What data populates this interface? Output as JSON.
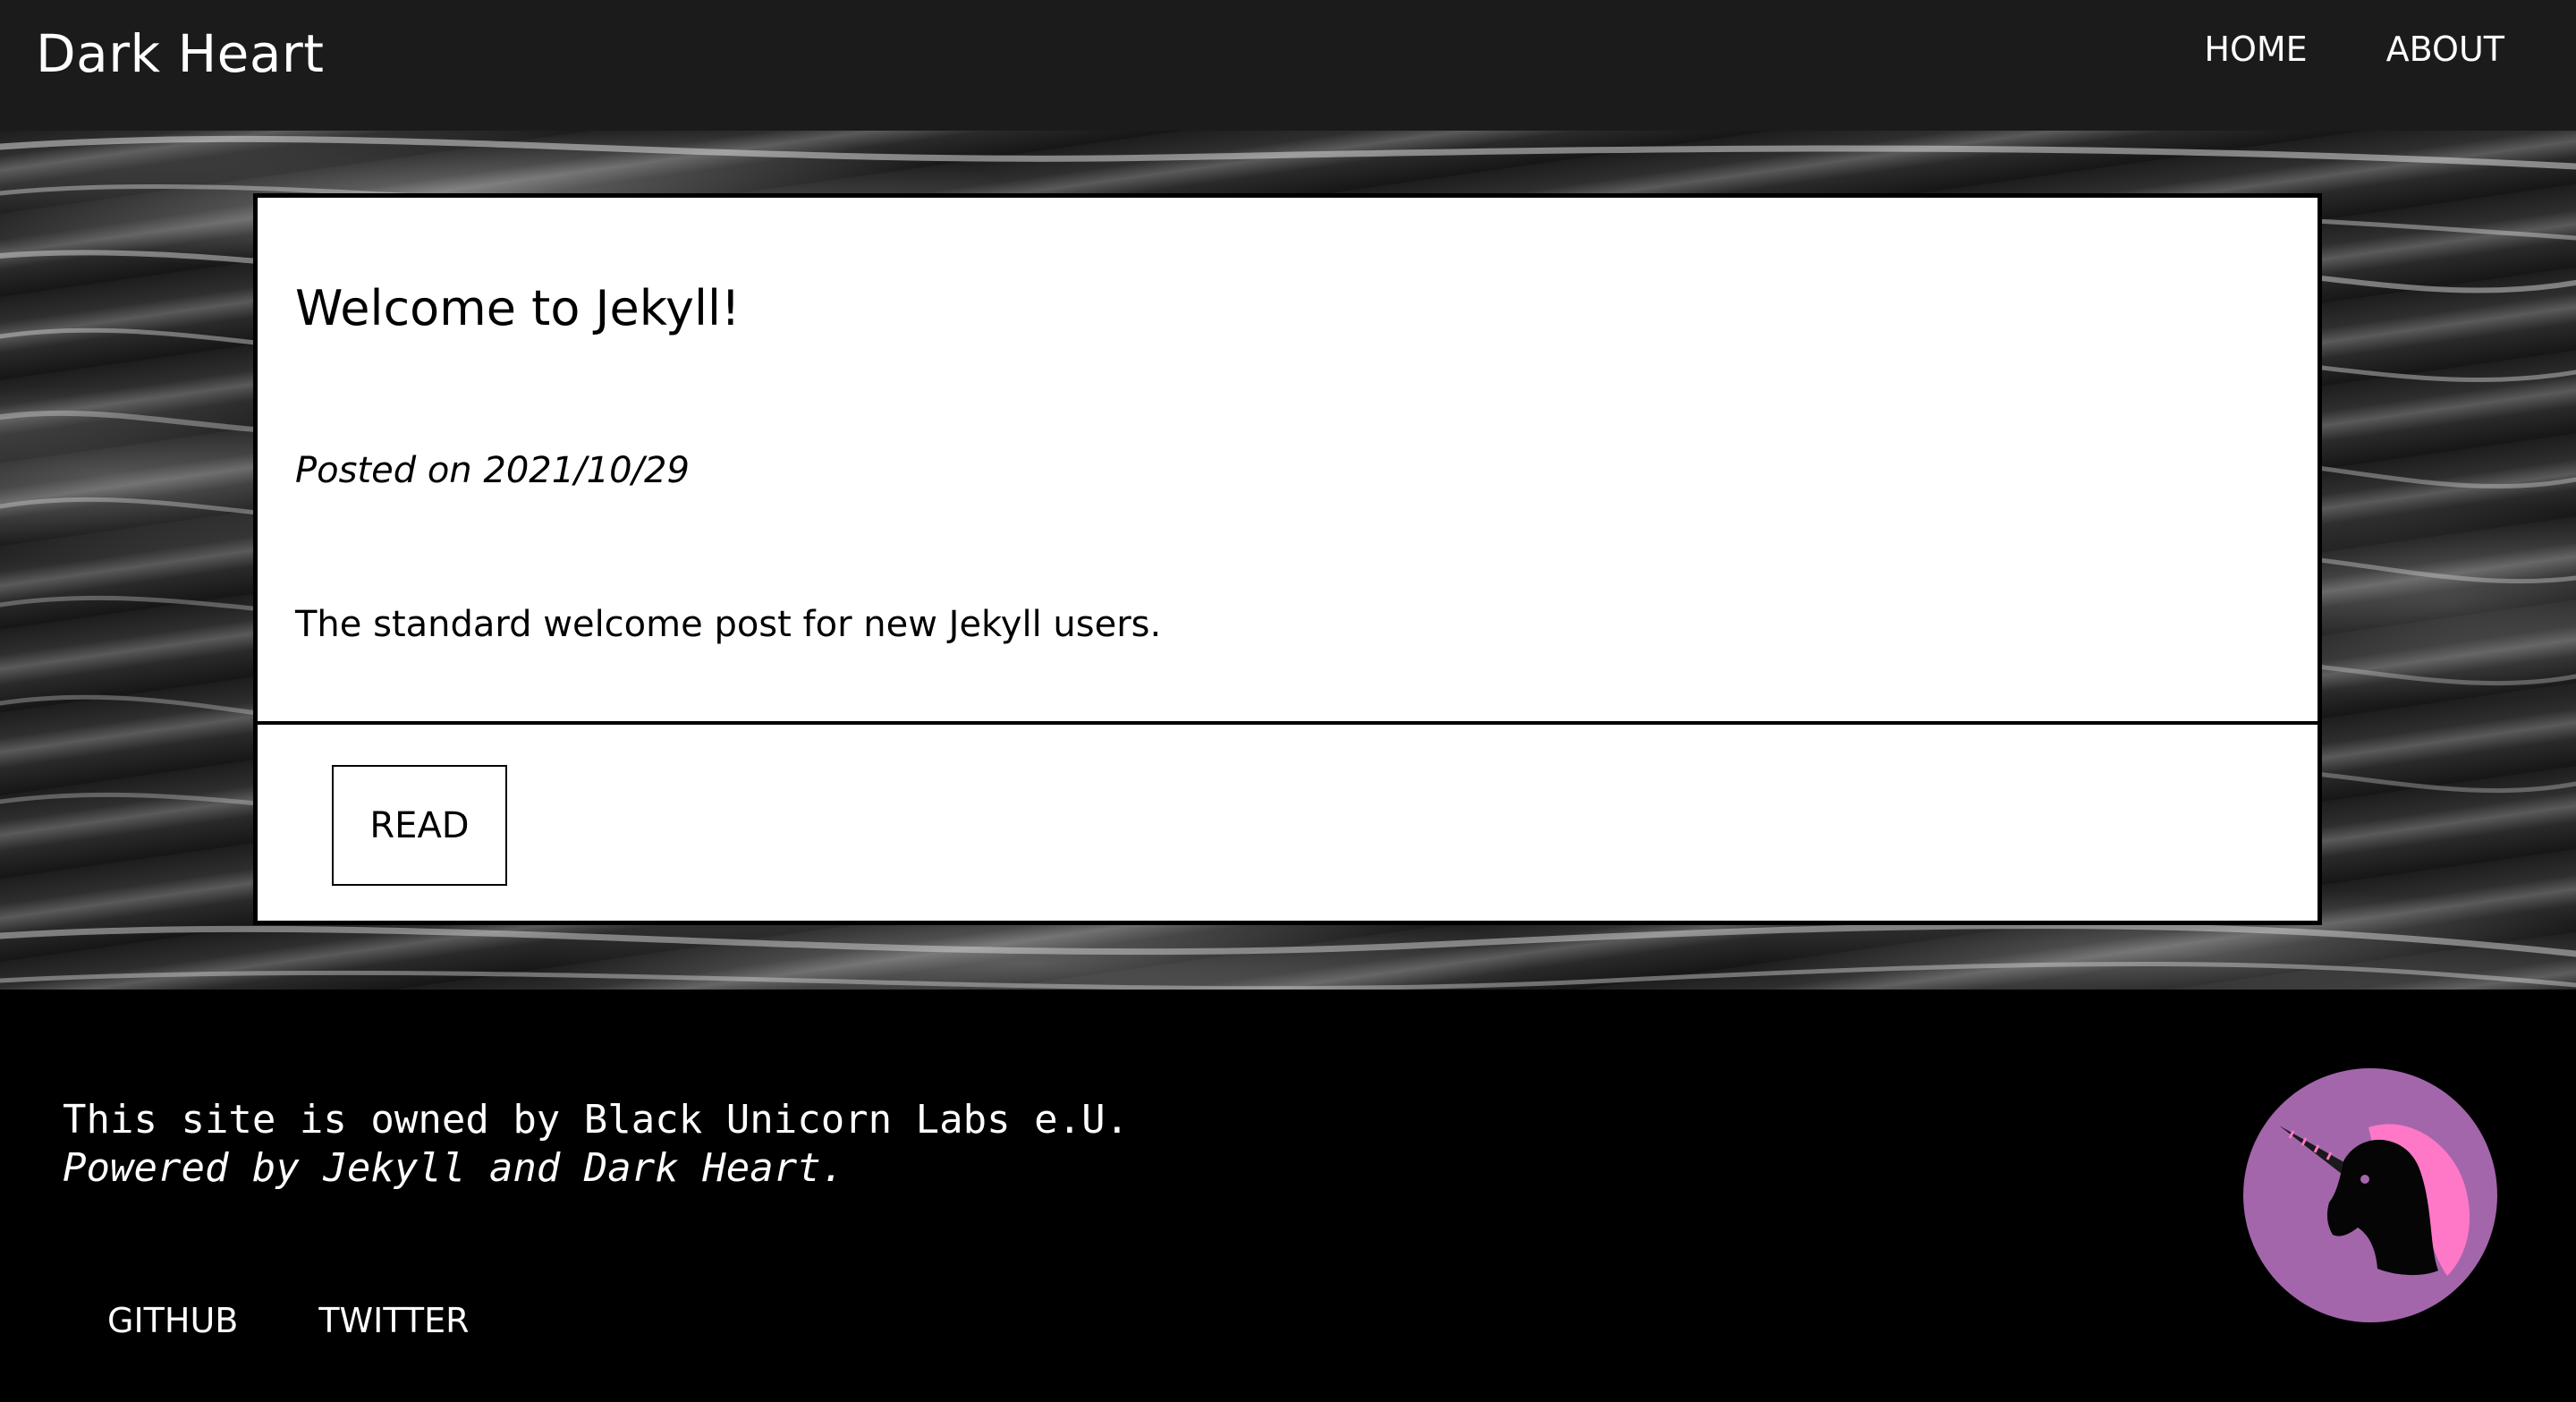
{
  "header": {
    "site_title": "Dark Heart",
    "nav": [
      {
        "label": "HOME"
      },
      {
        "label": "ABOUT"
      }
    ]
  },
  "post": {
    "title": "Welcome to Jekyll!",
    "date": "Posted on 2021/10/29",
    "excerpt": "The standard welcome post for new Jekyll users.",
    "read_label": "READ"
  },
  "footer": {
    "owner": "This site is owned by Black Unicorn Labs e.U.",
    "powered": "Powered by Jekyll and Dark Heart.",
    "links": [
      {
        "label": "GITHUB"
      },
      {
        "label": "TWITTER"
      }
    ],
    "logo_icon": "black-unicorn-logo",
    "logo_bg": "#a366ab",
    "mane_color": "#ff78c8"
  },
  "colors": {
    "header_bg": "#1b1b1b",
    "footer_bg": "#000000",
    "card_bg": "#ffffff"
  }
}
